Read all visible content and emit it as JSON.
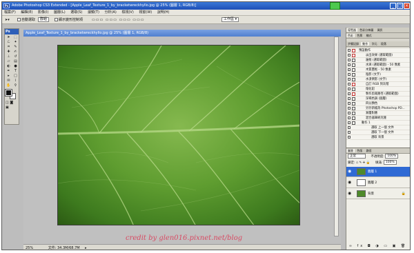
{
  "window": {
    "app_badge": "Ps",
    "title": "Adobe Photoshop CS3 Extended - [Apple_Leaf_Texture_1_by_bracketwreckhyllo.jpg @ 25% (圖層 1, RGB/8)]",
    "accent": "#2a5fc4"
  },
  "menu": [
    "檔案(F)",
    "編輯(E)",
    "影像(I)",
    "圖層(L)",
    "選取(S)",
    "濾鏡(T)",
    "分析(A)",
    "檢視(V)",
    "視窗(W)",
    "說明(H)"
  ],
  "options": {
    "auto_select": "自動選取",
    "group_value": "群組",
    "show_transform": "顯示變形控制項",
    "workspace": "工作區 ▾"
  },
  "toolbox": {
    "badge": "Ps",
    "tools": [
      "move",
      "marquee",
      "lasso",
      "quick-select",
      "crop",
      "slice",
      "healing",
      "brush",
      "stamp",
      "history-brush",
      "eraser",
      "gradient",
      "blur",
      "dodge",
      "pen",
      "type",
      "path-select",
      "shape",
      "notes",
      "eyedropper",
      "hand",
      "zoom"
    ]
  },
  "document": {
    "title": "Apple_Leaf_Texture_1_by_bracketwreckhyllo.jpg @ 25% (圖層 1, RGB/8)",
    "credit": "credit by glen016.pixnet.net/blog",
    "zoom": "25%",
    "doc_info": "文件: 34.3M/68.7M"
  },
  "panels": {
    "top_tabs": [
      "導覽器",
      "色彩分佈圖",
      "資訊"
    ],
    "mid_tabs": [
      "色彩",
      "色票",
      "樣式"
    ],
    "actions_tabs": [
      "步驟記錄",
      "動作",
      "字元",
      "段落"
    ],
    "actions": [
      "預設動作",
      "淡出效果 (選取範圍)",
      "邊框 (選取範圍)",
      "水滴 (選取範圍) - 50 像素",
      "木質畫框 - 50 像素",
      "陰影 (文字)",
      "水漾倒影 (文字)",
      "自訂 RGB 到灰階",
      "熔化鉛",
      "製作剪裁路徑 (選取範圍)",
      "深褐色調 (圖層)",
      "四分顏色",
      "另存新檔為 Photoshop PD...",
      "漸層對應",
      "混合器筆刷克隆",
      "動作 1",
      "選取 上一個 文件",
      "選取 下一個 文件",
      "選取 背景"
    ],
    "layers_tabs": [
      "圖層",
      "色版",
      "路徑"
    ],
    "blend_mode": "正常",
    "opacity_label": "不透明度:",
    "opacity_value": "100%",
    "lock_label": "鎖定:",
    "fill_label": "填滿:",
    "fill_value": "100%",
    "layers": [
      {
        "name": "圖層 1",
        "selected": true,
        "thumb": "#4e8a2a"
      },
      {
        "name": "圖層 2",
        "selected": false,
        "thumb": "#ffffff"
      },
      {
        "name": "背景",
        "selected": false,
        "thumb": "#4e8a2a"
      }
    ]
  },
  "colors": {
    "foreground": "#111111",
    "background": "#ffffff",
    "status_marker": "#4ec94e",
    "credit_color": "#d84a63"
  }
}
